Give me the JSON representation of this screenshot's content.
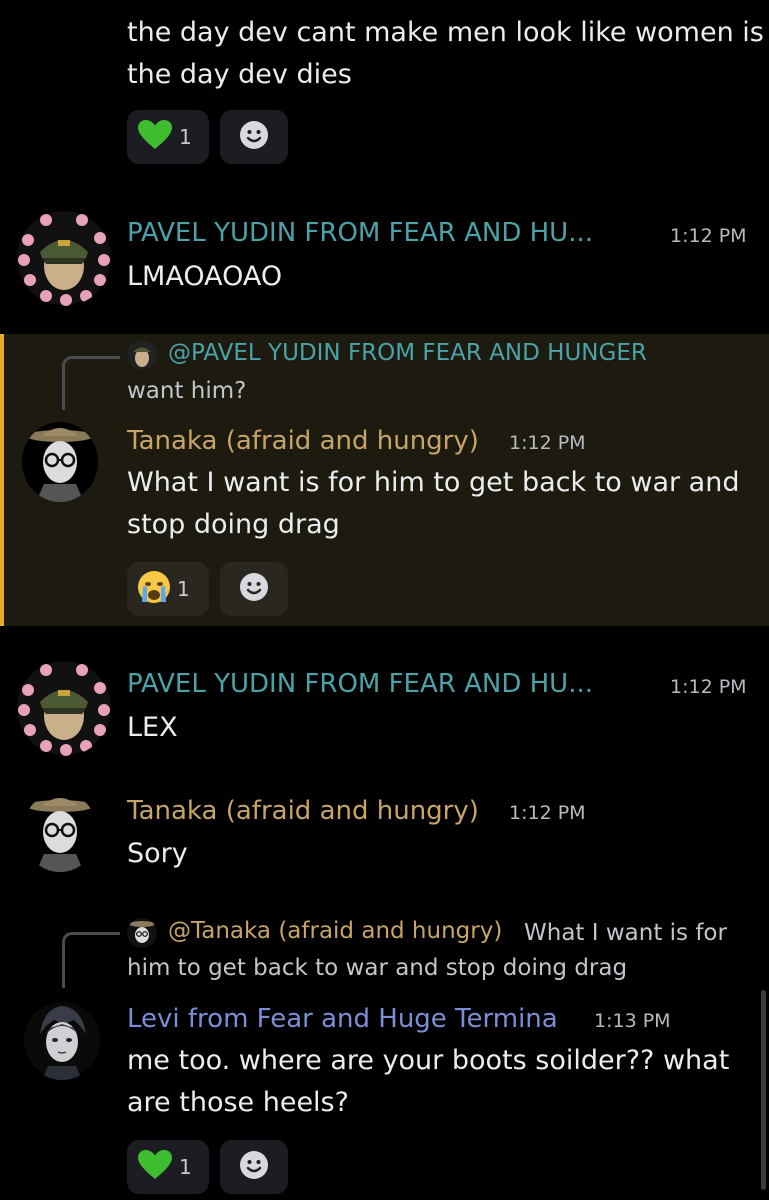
{
  "colors": {
    "pavel_name": "#4aa3a8",
    "tanaka_name": "#c8a566",
    "levi_name": "#7b8ed6",
    "highlight_bg": "#1d1a10",
    "highlight_bar": "#e9a827",
    "reaction_bg": "#1c1d22"
  },
  "messages": [
    {
      "continuation": true,
      "text_lines": [
        "the day dev cant make men look like women is",
        "the day dev dies"
      ],
      "reaction": {
        "emoji_name": "green-heart-icon",
        "count": "1"
      }
    },
    {
      "author": "PAVEL YUDIN FROM FEAR AND HU...",
      "time": "1:12 PM",
      "text": "LMAOAOAO"
    },
    {
      "reply": {
        "mention": "@PAVEL YUDIN FROM FEAR AND HUNGER",
        "preview": "want him?"
      },
      "author": "Tanaka (afraid and hungry)",
      "time": "1:12 PM",
      "text_lines": [
        "What I want is for him to get back to war and",
        "stop doing drag"
      ],
      "reaction": {
        "emoji_name": "crying-face-icon",
        "count": "1"
      }
    },
    {
      "author": "PAVEL YUDIN FROM FEAR AND HU...",
      "time": "1:12 PM",
      "text": "LEX"
    },
    {
      "author": "Tanaka (afraid and hungry)",
      "time": "1:12 PM",
      "text": "Sory"
    },
    {
      "reply": {
        "mention": "@Tanaka (afraid and hungry)",
        "preview_line1": "What I want is for",
        "preview_line2": "him to get back to war and stop doing drag"
      },
      "author": "Levi from Fear and Huge Termina",
      "time": "1:13 PM",
      "text_lines": [
        "me too. where are your boots soilder?? what",
        "are those heels?"
      ],
      "reaction": {
        "emoji_name": "green-heart-icon",
        "count": "1"
      }
    }
  ]
}
